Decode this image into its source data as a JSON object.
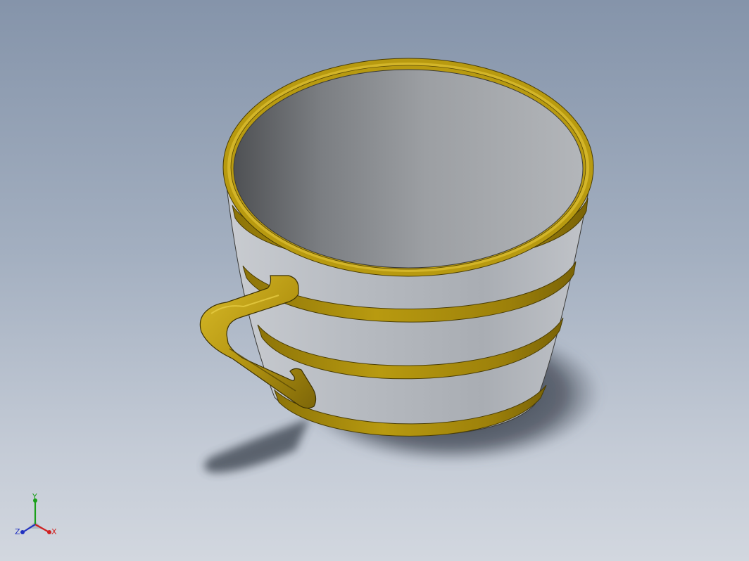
{
  "viewport": {
    "background_top": "#8594aa",
    "background_bottom": "#d2d7df"
  },
  "model": {
    "body_color": "#b9bdc3",
    "inner_color": "#9a9da3",
    "band_color": "#b89a10",
    "band_dark": "#6f5a05",
    "handle_color": "#c6a516",
    "shadow_color": "#2f3540"
  },
  "triad": {
    "x_label": "X",
    "y_label": "Y",
    "z_label": "Z",
    "x_color": "#d02020",
    "y_color": "#1aa01a",
    "z_color": "#2030c0"
  }
}
